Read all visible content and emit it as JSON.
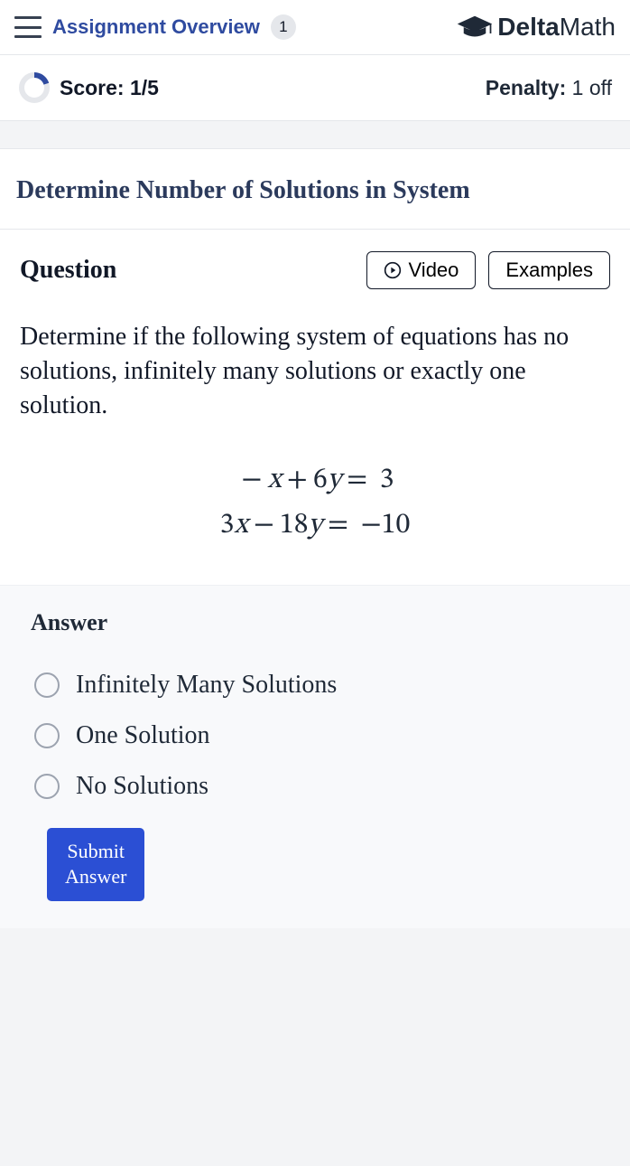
{
  "header": {
    "overview_label": "Assignment Overview",
    "badge_count": "1",
    "logo_bold": "Delta",
    "logo_light": "Math"
  },
  "score_bar": {
    "score_label": "Score:",
    "score_value": "1/5",
    "penalty_label": "Penalty:",
    "penalty_value": "1 off",
    "progress_fraction": 0.2
  },
  "problem": {
    "title": "Determine Number of Solutions in System",
    "question_heading": "Question",
    "video_label": "Video",
    "examples_label": "Examples",
    "prompt": "Determine if the following system of equations has no solutions, infinitely many solutions or exactly one solution.",
    "equations": [
      {
        "lhs_neg": "−",
        "a": "",
        "x_coef": "x",
        "op": "+",
        "b": "6",
        "y_coef": "y",
        "eq": "=",
        "rhs": "3"
      },
      {
        "lhs_neg": "",
        "a": "3",
        "x_coef": "x",
        "op": "−",
        "b": "18",
        "y_coef": "y",
        "eq": "=",
        "rhs": "−10"
      }
    ]
  },
  "answer": {
    "heading": "Answer",
    "choices": [
      "Infinitely Many Solutions",
      "One Solution",
      "No Solutions"
    ],
    "submit_label": "Submit Answer"
  }
}
